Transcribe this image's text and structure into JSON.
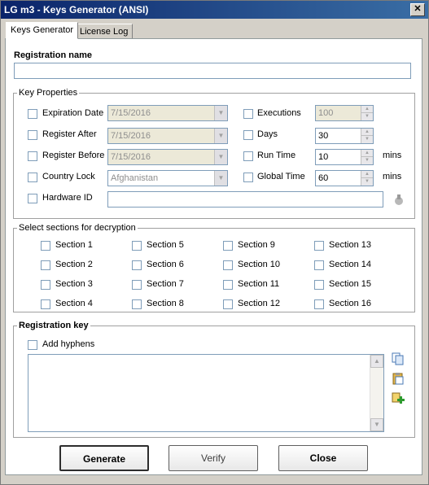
{
  "window": {
    "title": "LG m3 - Keys Generator (ANSI)",
    "close_glyph": "✕"
  },
  "tabs": [
    {
      "label": "Keys Generator"
    },
    {
      "label": "License Log"
    }
  ],
  "registration_name": {
    "label": "Registration name",
    "value": ""
  },
  "key_properties": {
    "title": "Key Properties",
    "expiration_date": {
      "label": "Expiration Date",
      "value": "7/15/2016"
    },
    "register_after": {
      "label": "Register After",
      "value": "7/15/2016"
    },
    "register_before": {
      "label": "Register Before",
      "value": "7/15/2016"
    },
    "country_lock": {
      "label": "Country Lock",
      "value": "Afghanistan"
    },
    "hardware_id": {
      "label": "Hardware ID",
      "value": ""
    },
    "executions": {
      "label": "Executions",
      "value": "100"
    },
    "days": {
      "label": "Days",
      "value": "30"
    },
    "run_time": {
      "label": "Run Time",
      "value": "10",
      "unit": "mins"
    },
    "global_time": {
      "label": "Global Time",
      "value": "60",
      "unit": "mins"
    }
  },
  "sections": {
    "title": "Select sections for decryption",
    "items": [
      "Section 1",
      "Section 2",
      "Section 3",
      "Section 4",
      "Section 5",
      "Section 6",
      "Section 7",
      "Section 8",
      "Section 9",
      "Section 10",
      "Section 11",
      "Section 12",
      "Section 13",
      "Section 14",
      "Section 15",
      "Section 16"
    ]
  },
  "registration_key": {
    "title": "Registration key",
    "add_hyphens": "Add hyphens",
    "value": ""
  },
  "buttons": {
    "generate": "Generate",
    "verify": "Verify",
    "close": "Close"
  }
}
